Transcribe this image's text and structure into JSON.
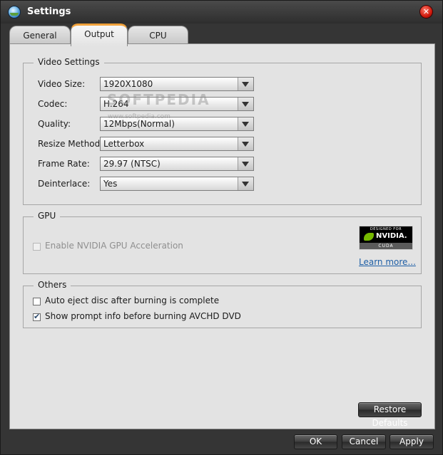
{
  "window": {
    "title": "Settings"
  },
  "tabs": [
    {
      "label": "General"
    },
    {
      "label": "Output"
    },
    {
      "label": "CPU"
    }
  ],
  "video_settings": {
    "legend": "Video Settings",
    "rows": [
      {
        "label": "Video Size:",
        "value": "1920X1080"
      },
      {
        "label": "Codec:",
        "value": "H.264"
      },
      {
        "label": "Quality:",
        "value": "12Mbps(Normal)"
      },
      {
        "label": "Resize Method:",
        "value": "Letterbox"
      },
      {
        "label": "Frame Rate:",
        "value": "29.97 (NTSC)"
      },
      {
        "label": "Deinterlace:",
        "value": "Yes"
      }
    ]
  },
  "watermark": {
    "text": "SOFTPEDIA",
    "sub": "www.softpedia.com"
  },
  "gpu": {
    "legend": "GPU",
    "enable_label": "Enable NVIDIA GPU Acceleration",
    "badge_top": "DESIGNED FOR",
    "badge_name": "NVIDIA.",
    "badge_bottom": "CUDA",
    "learn_more": "Learn more..."
  },
  "others": {
    "legend": "Others",
    "auto_eject_label": "Auto eject disc after burning is complete",
    "show_prompt_label": "Show prompt info before burning AVCHD DVD"
  },
  "buttons": {
    "restore_defaults": "Restore Defaults",
    "ok": "OK",
    "cancel": "Cancel",
    "apply": "Apply"
  },
  "colors": {
    "active_tab_accent": "#f0a13a",
    "nvidia_green": "#76b900",
    "link": "#1f5fa6"
  }
}
